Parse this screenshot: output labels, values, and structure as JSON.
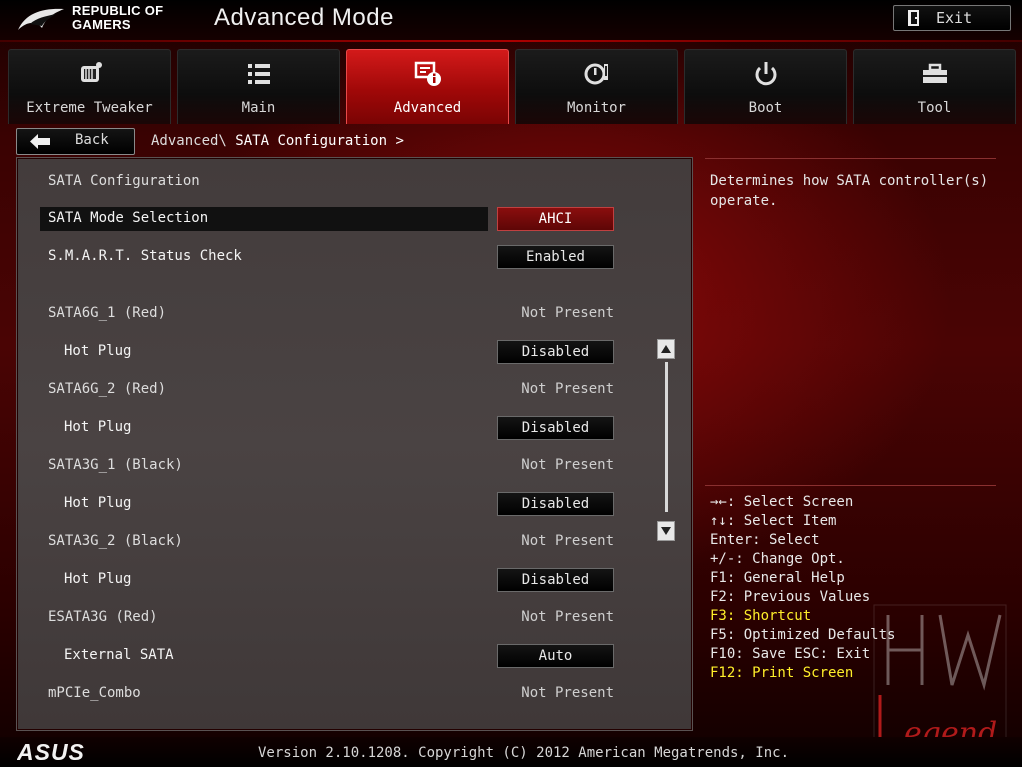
{
  "header": {
    "brand_line1": "REPUBLIC OF",
    "brand_line2": "GAMERS",
    "mode_title": "Advanced Mode",
    "exit_label": "Exit"
  },
  "tabs": [
    {
      "label": "Extreme Tweaker",
      "icon": "tweaker-icon",
      "active": false
    },
    {
      "label": "Main",
      "icon": "list-icon",
      "active": false
    },
    {
      "label": "Advanced",
      "icon": "advanced-info-icon",
      "active": true
    },
    {
      "label": "Monitor",
      "icon": "monitor-gauge-icon",
      "active": false
    },
    {
      "label": "Boot",
      "icon": "power-icon",
      "active": false
    },
    {
      "label": "Tool",
      "icon": "toolbox-icon",
      "active": false
    }
  ],
  "nav": {
    "back_label": "Back",
    "crumb_parent": "Advanced\\",
    "crumb_current": "SATA Configuration >"
  },
  "panel": {
    "section_title": "SATA Configuration",
    "rows": [
      {
        "label": "SATA Mode Selection",
        "value": "AHCI",
        "kind": "option",
        "selected": true
      },
      {
        "label": "S.M.A.R.T. Status Check",
        "value": "Enabled",
        "kind": "option"
      },
      {
        "label": "SATA6G_1 (Red)",
        "value": "Not Present",
        "kind": "status"
      },
      {
        "label": "Hot Plug",
        "value": "Disabled",
        "kind": "option"
      },
      {
        "label": "SATA6G_2 (Red)",
        "value": "Not Present",
        "kind": "status"
      },
      {
        "label": "Hot Plug",
        "value": "Disabled",
        "kind": "option"
      },
      {
        "label": "SATA3G_1 (Black)",
        "value": "Not Present",
        "kind": "status"
      },
      {
        "label": "Hot Plug",
        "value": "Disabled",
        "kind": "option"
      },
      {
        "label": "SATA3G_2 (Black)",
        "value": "Not Present",
        "kind": "status"
      },
      {
        "label": "Hot Plug",
        "value": "Disabled",
        "kind": "option"
      },
      {
        "label": "ESATA3G (Red)",
        "value": "Not Present",
        "kind": "status"
      },
      {
        "label": "External SATA",
        "value": "Auto",
        "kind": "option"
      },
      {
        "label": "mPCIe_Combo",
        "value": "Not Present",
        "kind": "status"
      }
    ]
  },
  "help": {
    "description": "Determines how SATA controller(s) operate."
  },
  "keys": [
    {
      "text": "→←: Select Screen",
      "highlight": false
    },
    {
      "text": "↑↓: Select Item",
      "highlight": false
    },
    {
      "text": "Enter: Select",
      "highlight": false
    },
    {
      "text": "+/-: Change Opt.",
      "highlight": false
    },
    {
      "text": "F1: General Help",
      "highlight": false
    },
    {
      "text": "F2: Previous Values",
      "highlight": false
    },
    {
      "text": "F3: Shortcut",
      "highlight": true
    },
    {
      "text": "F5: Optimized Defaults",
      "highlight": false
    },
    {
      "text": "F10: Save  ESC: Exit",
      "highlight": false
    },
    {
      "text": "F12: Print Screen",
      "highlight": true
    }
  ],
  "watermark": {
    "line1": "HW",
    "line2": "Legend"
  },
  "footer": {
    "brand": "ASUS",
    "version": "Version 2.10.1208. Copyright (C) 2012 American Megatrends, Inc."
  },
  "colors": {
    "accent_red": "#c01010",
    "selected_option": "#7a0a0a",
    "highlight_key": "#ffef2a"
  }
}
